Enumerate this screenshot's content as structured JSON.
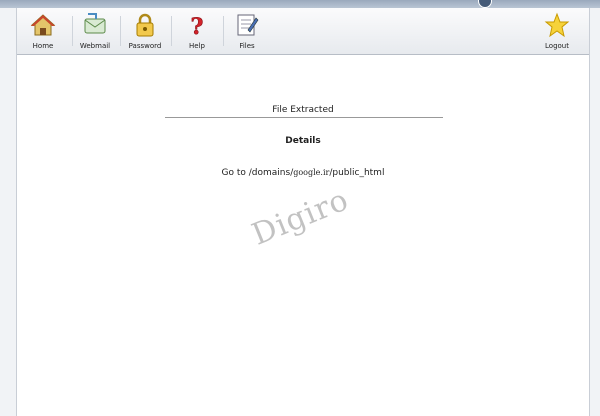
{
  "toolbar": {
    "items": [
      {
        "label": "Home",
        "icon": "home-icon"
      },
      {
        "label": "Webmail",
        "icon": "mail-icon"
      },
      {
        "label": "Password",
        "icon": "lock-icon"
      },
      {
        "label": "Help",
        "icon": "question-icon"
      },
      {
        "label": "Files",
        "icon": "files-icon"
      }
    ],
    "logout": {
      "label": "Logout",
      "icon": "star-icon"
    }
  },
  "main": {
    "status": "File Extracted",
    "details_heading": "Details",
    "goto_prefix": "Go to /domains/",
    "goto_domain": "google.ir",
    "goto_suffix": "/public_html"
  },
  "watermark": "Digiro",
  "colors": {
    "toolbar_bg": "#e9ecf0",
    "top_band": "#9aa9bd",
    "panel_border": "#c9ced6"
  }
}
